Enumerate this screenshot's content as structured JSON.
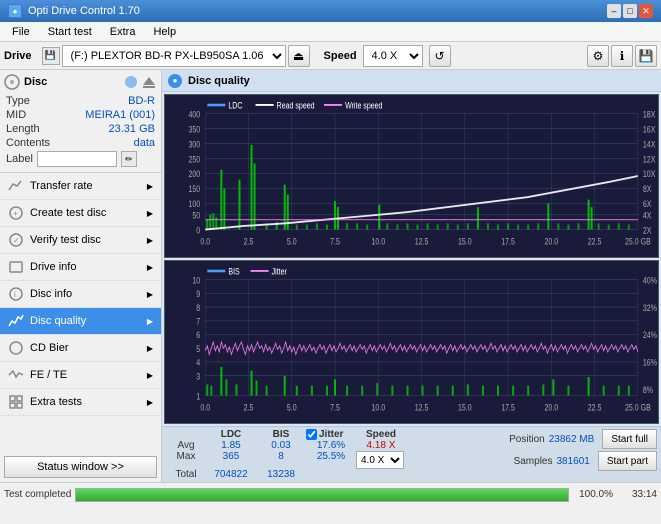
{
  "titlebar": {
    "title": "Opti Drive Control 1.70",
    "minimize": "–",
    "maximize": "□",
    "close": "✕"
  },
  "menubar": {
    "items": [
      "File",
      "Start test",
      "Extra",
      "Help"
    ]
  },
  "toolbar": {
    "drive_label": "Drive",
    "drive_value": "(F:) PLEXTOR BD-R  PX-LB950SA 1.06",
    "speed_label": "Speed",
    "speed_value": "4.0 X"
  },
  "disc": {
    "type_label": "Type",
    "type_value": "BD-R",
    "mid_label": "MID",
    "mid_value": "MEIRA1 (001)",
    "length_label": "Length",
    "length_value": "23.31 GB",
    "contents_label": "Contents",
    "contents_value": "data",
    "label_label": "Label"
  },
  "nav": {
    "items": [
      {
        "id": "transfer-rate",
        "label": "Transfer rate",
        "active": false
      },
      {
        "id": "create-test-disc",
        "label": "Create test disc",
        "active": false
      },
      {
        "id": "verify-test-disc",
        "label": "Verify test disc",
        "active": false
      },
      {
        "id": "drive-info",
        "label": "Drive info",
        "active": false
      },
      {
        "id": "disc-info",
        "label": "Disc info",
        "active": false
      },
      {
        "id": "disc-quality",
        "label": "Disc quality",
        "active": true
      },
      {
        "id": "cd-bier",
        "label": "CD Bier",
        "active": false
      },
      {
        "id": "fe-te",
        "label": "FE / TE",
        "active": false
      },
      {
        "id": "extra-tests",
        "label": "Extra tests",
        "active": false
      }
    ],
    "status_button": "Status window >>"
  },
  "disc_quality_header": "Disc quality",
  "chart1": {
    "title": "LDC / Read speed / Write speed",
    "legend": {
      "ldc": "LDC",
      "read": "Read speed",
      "write": "Write speed"
    },
    "y_left_max": 400,
    "y_left_labels": [
      "400",
      "350",
      "300",
      "250",
      "200",
      "150",
      "100",
      "50",
      "0"
    ],
    "y_right_labels": [
      "18X",
      "16X",
      "14X",
      "12X",
      "10X",
      "8X",
      "6X",
      "4X",
      "2X"
    ],
    "x_labels": [
      "0.0",
      "2.5",
      "5.0",
      "7.5",
      "10.0",
      "12.5",
      "15.0",
      "17.5",
      "20.0",
      "22.5",
      "25.0 GB"
    ]
  },
  "chart2": {
    "title": "BIS / Jitter",
    "legend": {
      "bis": "BIS",
      "jitter": "Jitter"
    },
    "y_left_max": 10,
    "y_left_labels": [
      "10",
      "9",
      "8",
      "7",
      "6",
      "5",
      "4",
      "3",
      "2",
      "1"
    ],
    "y_right_labels": [
      "40%",
      "32%",
      "24%",
      "16%",
      "8%"
    ],
    "x_labels": [
      "0.0",
      "2.5",
      "5.0",
      "7.5",
      "10.0",
      "12.5",
      "15.0",
      "17.5",
      "20.0",
      "22.5",
      "25.0 GB"
    ]
  },
  "stats": {
    "headers": [
      "",
      "LDC",
      "BIS",
      "",
      "Jitter",
      "Speed"
    ],
    "rows": [
      {
        "label": "Avg",
        "ldc": "1.85",
        "bis": "0.03",
        "jitter": "17.6%"
      },
      {
        "label": "Max",
        "ldc": "365",
        "bis": "8",
        "jitter": "25.5%"
      },
      {
        "label": "Total",
        "ldc": "704822",
        "bis": "13238",
        "jitter": ""
      }
    ],
    "speed_avg": "4.18 X",
    "speed_select": "4.0 X",
    "position_label": "Position",
    "position_value": "23862 MB",
    "samples_label": "Samples",
    "samples_value": "381601",
    "jitter_checked": true,
    "jitter_label": "Jitter",
    "start_full_label": "Start full",
    "start_part_label": "Start part"
  },
  "bottom": {
    "status_text": "Test completed",
    "progress_pct": "100.0%",
    "time": "33:14",
    "progress_value": 100
  }
}
